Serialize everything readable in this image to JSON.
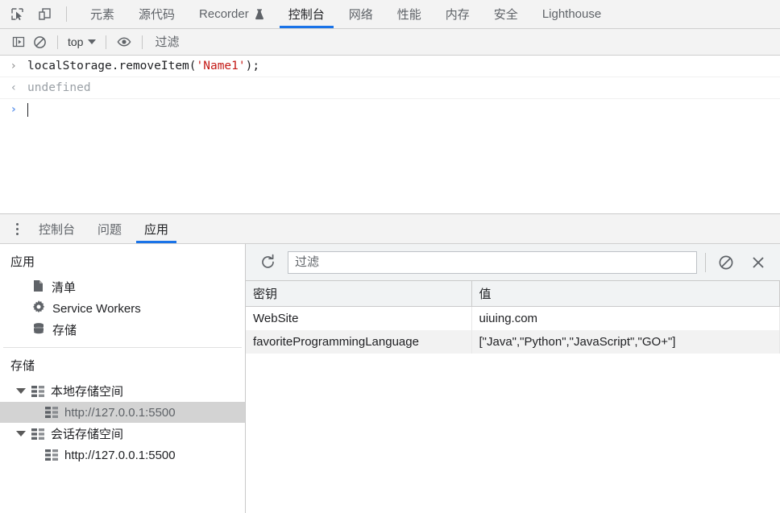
{
  "toolbar": {
    "inspect_icon": "inspect-cursor-icon",
    "device_icon": "device-toolbar-icon",
    "tabs": [
      {
        "label": "元素",
        "active": false
      },
      {
        "label": "源代码",
        "active": false
      },
      {
        "label": "Recorder",
        "active": false,
        "badge_icon": "flask-icon"
      },
      {
        "label": "控制台",
        "active": true
      },
      {
        "label": "网络",
        "active": false
      },
      {
        "label": "性能",
        "active": false
      },
      {
        "label": "内存",
        "active": false
      },
      {
        "label": "安全",
        "active": false
      },
      {
        "label": "Lighthouse",
        "active": false
      }
    ],
    "active_underline_color": "#1a73e8"
  },
  "console_toolbar": {
    "sidebar_toggle_icon": "console-sidebar-icon",
    "clear_icon": "clear-console-icon",
    "context_label": "top",
    "eye_icon": "live-expression-icon",
    "filter_placeholder": "过滤",
    "filter_value": ""
  },
  "console": {
    "messages": [
      {
        "type": "input",
        "marker": "›",
        "text": "localStorage.removeItem('Name1');",
        "code_prefix": "localStorage.removeItem(",
        "code_string": "'Name1'",
        "code_suffix": ");"
      },
      {
        "type": "output",
        "marker": "‹",
        "text": "undefined"
      }
    ],
    "prompt_marker": "›",
    "prompt_value": ""
  },
  "drawer": {
    "kebab_icon": "more-options-icon",
    "tabs": [
      {
        "label": "控制台",
        "active": false
      },
      {
        "label": "问题",
        "active": false
      },
      {
        "label": "应用",
        "active": true
      }
    ]
  },
  "sidebar": {
    "application": {
      "title": "应用",
      "items": [
        {
          "label": "清单",
          "icon": "manifest-document-icon"
        },
        {
          "label": "Service Workers",
          "icon": "gear-icon"
        },
        {
          "label": "存储",
          "icon": "database-icon"
        }
      ]
    },
    "storage": {
      "title": "存储",
      "tree": [
        {
          "label": "本地存储空间",
          "icon": "table-grid-icon",
          "expanded": true,
          "children": [
            {
              "label": "http://127.0.0.1:5500",
              "icon": "table-grid-icon",
              "selected": true
            }
          ]
        },
        {
          "label": "会话存储空间",
          "icon": "table-grid-icon",
          "expanded": true,
          "children": [
            {
              "label": "http://127.0.0.1:5500",
              "icon": "table-grid-icon",
              "selected": false
            }
          ]
        }
      ]
    }
  },
  "storage_panel": {
    "refresh_icon": "refresh-icon",
    "clear_all_icon": "clear-all-icon",
    "delete_selected_icon": "delete-selected-icon",
    "filter_placeholder": "过滤",
    "filter_value": "",
    "table": {
      "columns": [
        "密钥",
        "值"
      ],
      "rows": [
        [
          "WebSite",
          "uiuing.com"
        ],
        [
          "favoriteProgrammingLanguage",
          "[\"Java\",\"Python\",\"JavaScript\",\"GO+\"]"
        ]
      ]
    }
  },
  "colors": {
    "accent": "#1a73e8",
    "toolbar_bg": "#f3f3f3",
    "panel_bg": "#ffffff",
    "selected_row": "#d3d3d3",
    "string_literal": "#c41a16",
    "muted_text": "#9aa0a6"
  }
}
